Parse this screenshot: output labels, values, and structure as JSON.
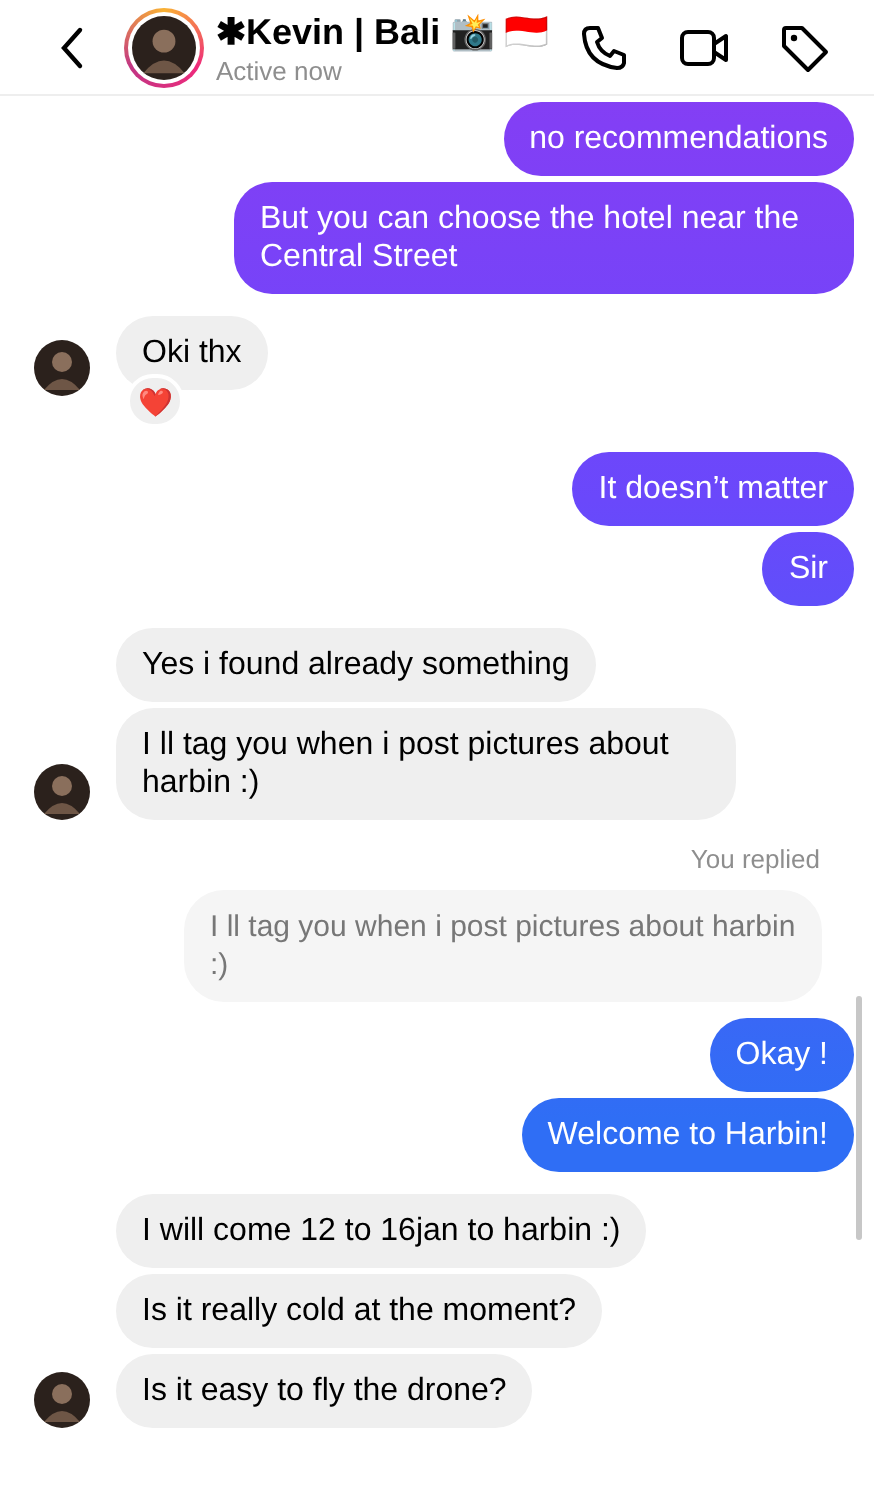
{
  "header": {
    "name": "✱Kevin | Bali 📸 🇮🇩",
    "status": "Active now"
  },
  "messages": [
    {
      "kind": "outgoing",
      "text": "no recommendations"
    },
    {
      "kind": "outgoing",
      "text": "But you can choose the hotel near the Central Street"
    },
    {
      "kind": "incoming",
      "text": "Oki thx",
      "reaction": "❤️",
      "avatar": true
    },
    {
      "kind": "outgoing",
      "text": "It doesn’t matter"
    },
    {
      "kind": "outgoing",
      "text": "Sir"
    },
    {
      "kind": "incoming",
      "text": "Yes i found already something",
      "avatar": false
    },
    {
      "kind": "incoming",
      "text": "I ll tag you when i post pictures about harbin :)",
      "avatar": true
    },
    {
      "kind": "reply_label",
      "text": "You replied"
    },
    {
      "kind": "quote",
      "text": "I ll tag you when i post pictures about harbin :)"
    },
    {
      "kind": "outgoing",
      "text": "Okay !"
    },
    {
      "kind": "outgoing",
      "text": "Welcome to Harbin!"
    },
    {
      "kind": "incoming",
      "text": "I will come 12 to 16jan to harbin :)",
      "avatar": false
    },
    {
      "kind": "incoming",
      "text": "Is it really cold at the moment?",
      "avatar": false
    },
    {
      "kind": "incoming",
      "text": "Is it easy to fly the drone?",
      "avatar": true
    }
  ]
}
